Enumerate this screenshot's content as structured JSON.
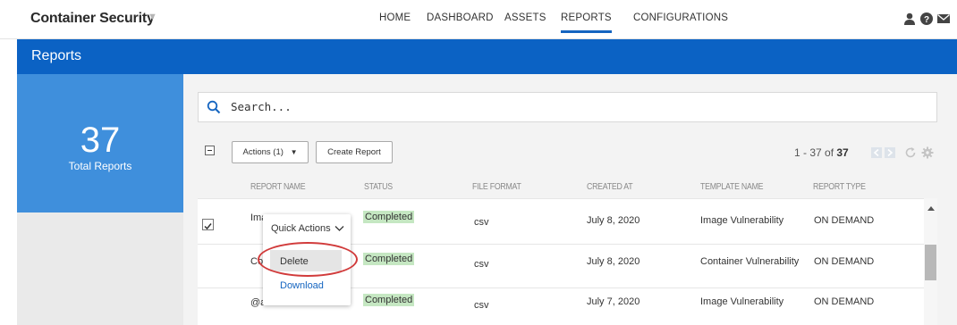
{
  "app": {
    "title": "Container Security"
  },
  "nav": {
    "items": [
      {
        "label": "HOME"
      },
      {
        "label": "DASHBOARD"
      },
      {
        "label": "ASSETS"
      },
      {
        "label": "REPORTS",
        "active": true
      },
      {
        "label": "CONFIGURATIONS"
      }
    ],
    "icons": [
      "user-icon",
      "help-icon",
      "mail-icon"
    ]
  },
  "page": {
    "title": "Reports"
  },
  "summary": {
    "count": "37",
    "label": "Total Reports"
  },
  "search": {
    "placeholder": "Search..."
  },
  "toolbar": {
    "actions_label": "Actions (1)",
    "create_label": "Create Report"
  },
  "pager": {
    "range": "1 - 37 of ",
    "total": "37"
  },
  "table": {
    "columns": [
      "REPORT NAME",
      "STATUS",
      "FILE FORMAT",
      "CREATED AT",
      "TEMPLATE NAME",
      "REPORT TYPE"
    ],
    "rows": [
      {
        "name": "Ima",
        "status": "Completed",
        "format": "csv",
        "created": "July 8, 2020",
        "template": "Image Vulnerability",
        "type": "ON DEMAND",
        "checked": true
      },
      {
        "name": "Co",
        "status": "Completed",
        "format": "csv",
        "created": "July 8, 2020",
        "template": "Container Vulnerability",
        "type": "ON DEMAND",
        "checked": false
      },
      {
        "name": "@a",
        "status": "Completed",
        "format": "csv",
        "created": "July 7, 2020",
        "template": "Image Vulnerability",
        "type": "ON DEMAND",
        "checked": false
      }
    ]
  },
  "quick_actions": {
    "title": "Quick Actions",
    "items": [
      "Delete",
      "Download"
    ]
  },
  "colors": {
    "brand_blue": "#0b62c4",
    "card_blue": "#3f8fdc",
    "completed_bg": "#c5e7c2",
    "highlight_ring": "#d13b3b"
  }
}
